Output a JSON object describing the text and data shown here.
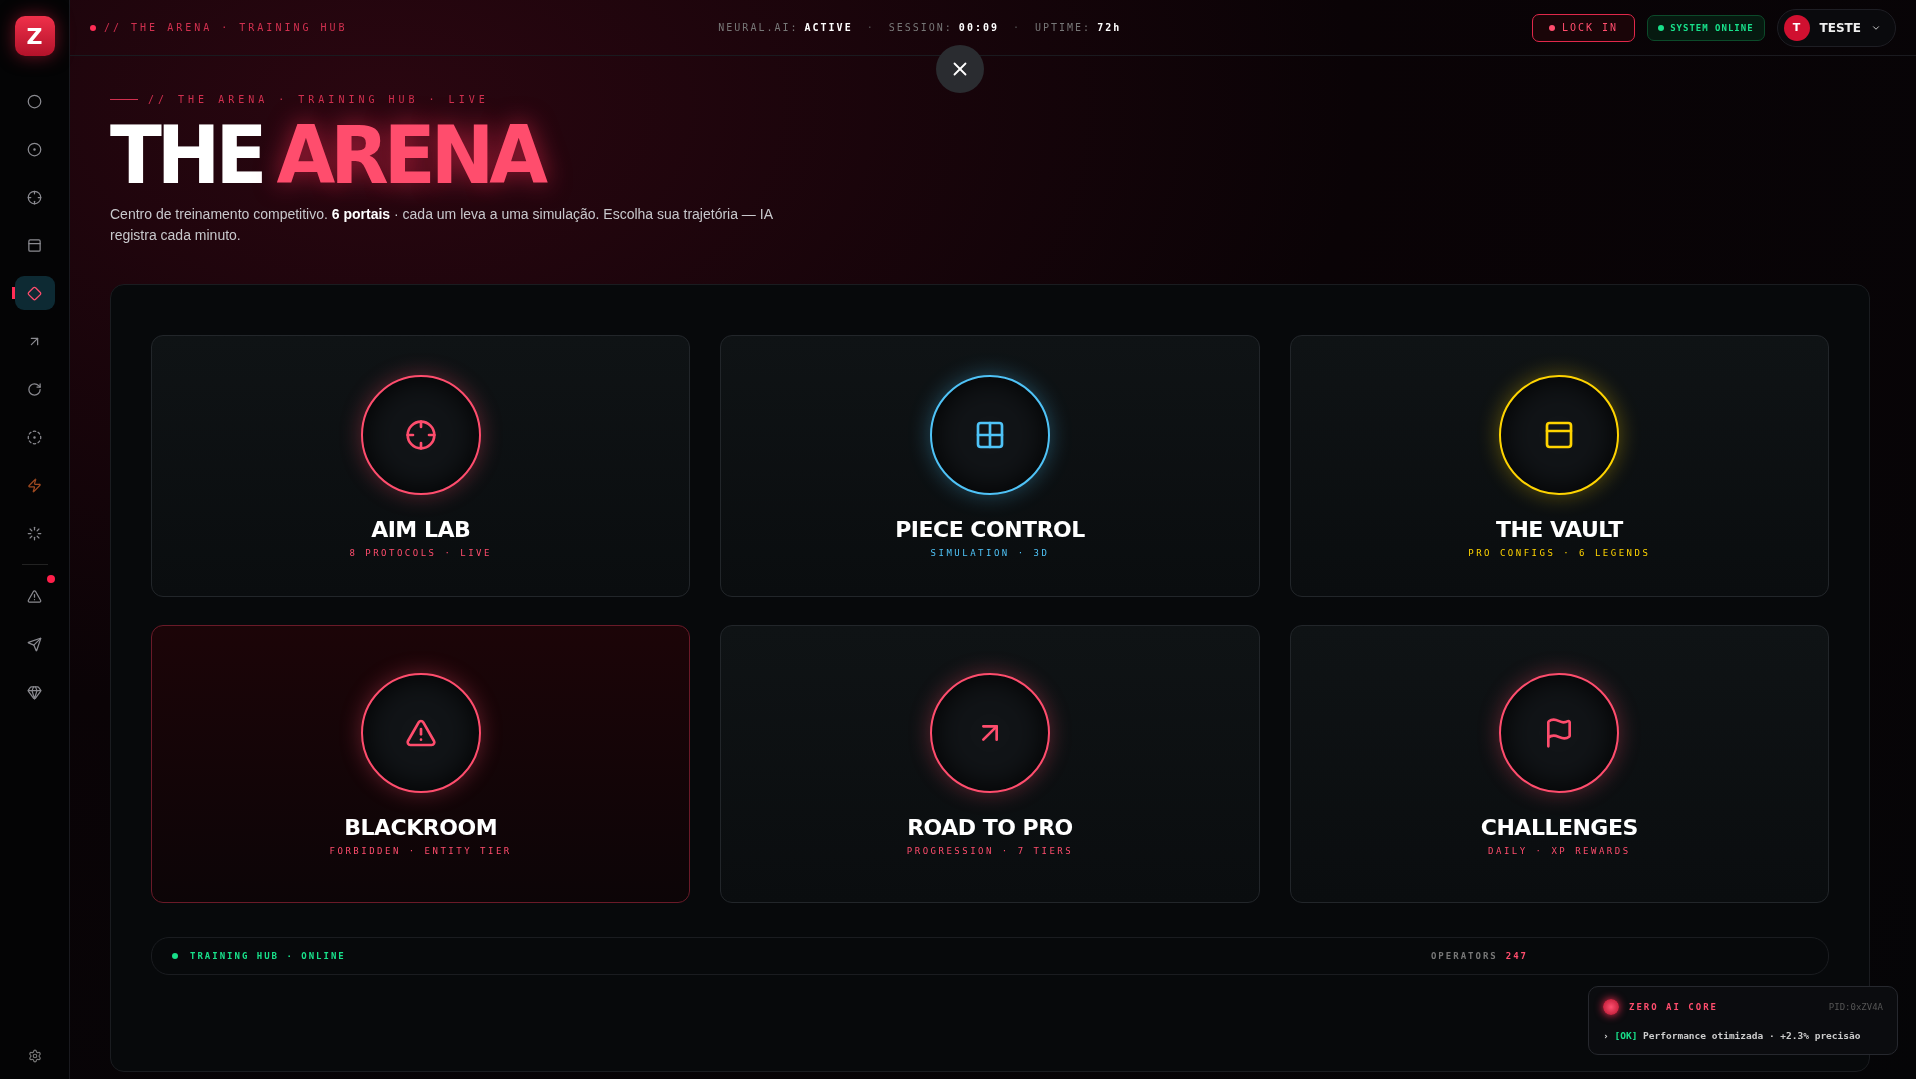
{
  "sidebar": {
    "logo": "Z",
    "items": [
      {
        "kind": "record",
        "selected": false,
        "badge": false
      },
      {
        "kind": "target",
        "selected": false,
        "badge": false
      },
      {
        "kind": "crosshair",
        "selected": false,
        "badge": false
      },
      {
        "kind": "panel",
        "selected": false,
        "badge": false
      },
      {
        "kind": "diamond",
        "selected": true,
        "badge": false
      },
      {
        "kind": "arrow",
        "selected": false,
        "badge": false
      },
      {
        "kind": "refresh",
        "selected": false,
        "badge": false
      },
      {
        "kind": "dot",
        "selected": false,
        "badge": false
      },
      {
        "kind": "bolt",
        "selected": false,
        "badge": false
      },
      {
        "kind": "loader",
        "selected": false,
        "badge": false
      },
      {
        "kind": "warning",
        "selected": false,
        "badge": true
      },
      {
        "kind": "send",
        "selected": false,
        "badge": false
      },
      {
        "kind": "gem",
        "selected": false,
        "badge": false
      }
    ]
  },
  "topbar": {
    "breadcrumb": "// THE ARENA · TRAINING HUB",
    "stats": [
      {
        "label": "NEURAL.AI:",
        "value": "ACTIVE"
      },
      {
        "label": "SESSION:",
        "value": "00:09"
      },
      {
        "label": "UPTIME:",
        "value": "72h"
      }
    ],
    "separator": "·",
    "lock_button": "LOCK IN",
    "status": "SYSTEM ONLINE",
    "user": {
      "initial": "T",
      "name": "TESTE"
    }
  },
  "hero": {
    "eyebrow": "// THE ARENA · TRAINING HUB · LIVE",
    "title_lead": "THE",
    "title_accent": "ARENA",
    "description": "Centro de treinamento competitivo. **6 portais** · cada um leva a uma simulação. Escolha sua trajetória — IA registra cada minuto."
  },
  "portals": [
    {
      "kind": "crosshair",
      "title": "AIM LAB",
      "subtitle": "8 PROTOCOLS · LIVE",
      "color": "#ff4d6d",
      "highlighted": false
    },
    {
      "kind": "grid",
      "title": "PIECE CONTROL",
      "subtitle": "SIMULATION · 3D",
      "color": "#4fc3f7",
      "highlighted": false
    },
    {
      "kind": "panel",
      "title": "THE VAULT",
      "subtitle": "PRO CONFIGS · 6 LEGENDS",
      "color": "#ffd400",
      "highlighted": false
    },
    {
      "kind": "warning",
      "title": "BLACKROOM",
      "subtitle": "FORBIDDEN · ENTITY TIER",
      "color": "#ff4d6d",
      "highlighted": true
    },
    {
      "kind": "arrow",
      "title": "ROAD TO PRO",
      "subtitle": "PROGRESSION · 7 TIERS",
      "color": "#ff4d6d",
      "highlighted": false
    },
    {
      "kind": "flag",
      "title": "CHALLENGES",
      "subtitle": "DAILY · XP REWARDS",
      "color": "#ff4d6d",
      "highlighted": false
    }
  ],
  "hub_footer": {
    "status": "TRAINING HUB · ONLINE",
    "operators_label": "OPERATORS",
    "operators_value": "247"
  },
  "toast": {
    "title": "ZERO AI CORE",
    "pid": "PID:0xZV4A",
    "prompt": "›",
    "tag": "[OK]",
    "message": "Performance otimizada · +2.3% precisão"
  }
}
